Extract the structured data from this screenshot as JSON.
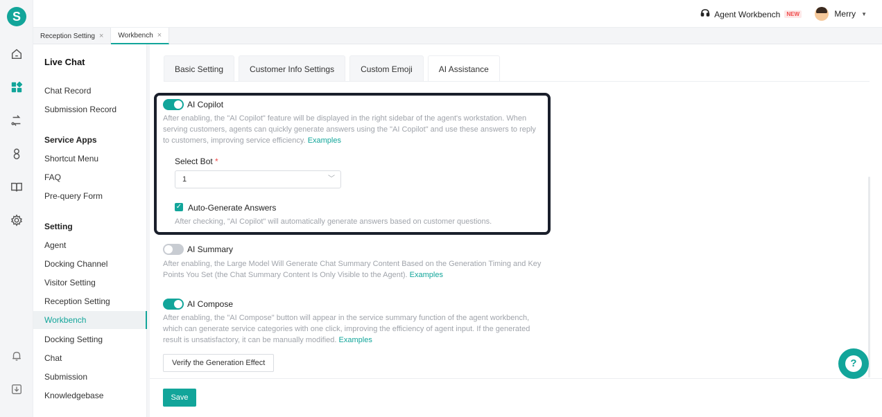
{
  "app": {
    "logo_letter": "S",
    "brand_color": "#12a59a"
  },
  "topbar": {
    "agent_workbench": "Agent Workbench",
    "new_badge": "NEW",
    "user_name": "Merry"
  },
  "page_tabs": [
    {
      "label": "Reception Setting",
      "close": "×"
    },
    {
      "label": "Workbench",
      "close": "×"
    }
  ],
  "sidebar": {
    "title": "Live Chat",
    "items_top": [
      "Chat Record",
      "Submission Record"
    ],
    "group_service": "Service Apps",
    "service_items": [
      "Shortcut Menu",
      "FAQ",
      "Pre-query Form"
    ],
    "group_setting": "Setting",
    "setting_items": [
      "Agent",
      "Docking Channel",
      "Visitor Setting",
      "Reception Setting",
      "Workbench",
      "Docking Setting",
      "Chat",
      "Submission",
      "Knowledgebase"
    ]
  },
  "tabs": [
    "Basic Setting",
    "Customer Info Settings",
    "Custom Emoji",
    "AI Assistance"
  ],
  "copilot": {
    "title": "AI Copilot",
    "desc": "After enabling, the \"AI Copilot\" feature will be displayed in the right sidebar of the agent's workstation. When serving customers, agents can quickly generate answers using the \"AI Copilot\" and use these answers to reply to customers, improving service efficiency.",
    "examples": "Examples",
    "select_label": "Select Bot",
    "required_mark": "*",
    "select_value": "1",
    "auto_label": "Auto-Generate Answers",
    "auto_desc": "After checking, \"AI Copilot\" will automatically generate answers based on customer questions."
  },
  "summary": {
    "title": "AI Summary",
    "desc": "After enabling, the Large Model Will Generate Chat Summary Content Based on the Generation Timing and Key Points You Set (the Chat Summary Content Is Only Visible to the Agent).",
    "examples": "Examples"
  },
  "compose": {
    "title": "AI Compose",
    "desc": "After enabling, the \"AI Compose\" button will appear in the service summary function of the agent workbench, which can generate service categories with one click, improving the efficiency of agent input. If the generated result is unsatisfactory, it can be manually modified.",
    "examples": "Examples",
    "verify_button": "Verify the Generation Effect"
  },
  "save_button": "Save",
  "help_glyph": "?"
}
